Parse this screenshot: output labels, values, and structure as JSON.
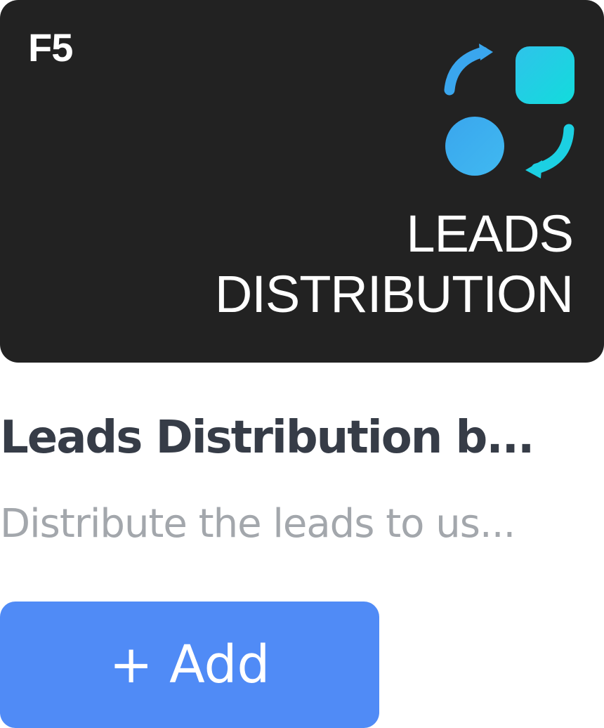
{
  "banner": {
    "badge": "F5",
    "title_line1": "LEADS",
    "title_line2": "DISTRIBUTION",
    "background": "#222222",
    "logo_icon": "leads-distribution-logo-icon",
    "accent_colors": [
      "#3aa6ee",
      "#19d6df"
    ]
  },
  "card": {
    "title": "Leads Distribution b...",
    "description": "Distribute the leads to us...",
    "title_color": "#363c47",
    "description_color": "#a3a7ac"
  },
  "actions": {
    "add_label": "+ Add",
    "button_color": "#508bf6"
  }
}
